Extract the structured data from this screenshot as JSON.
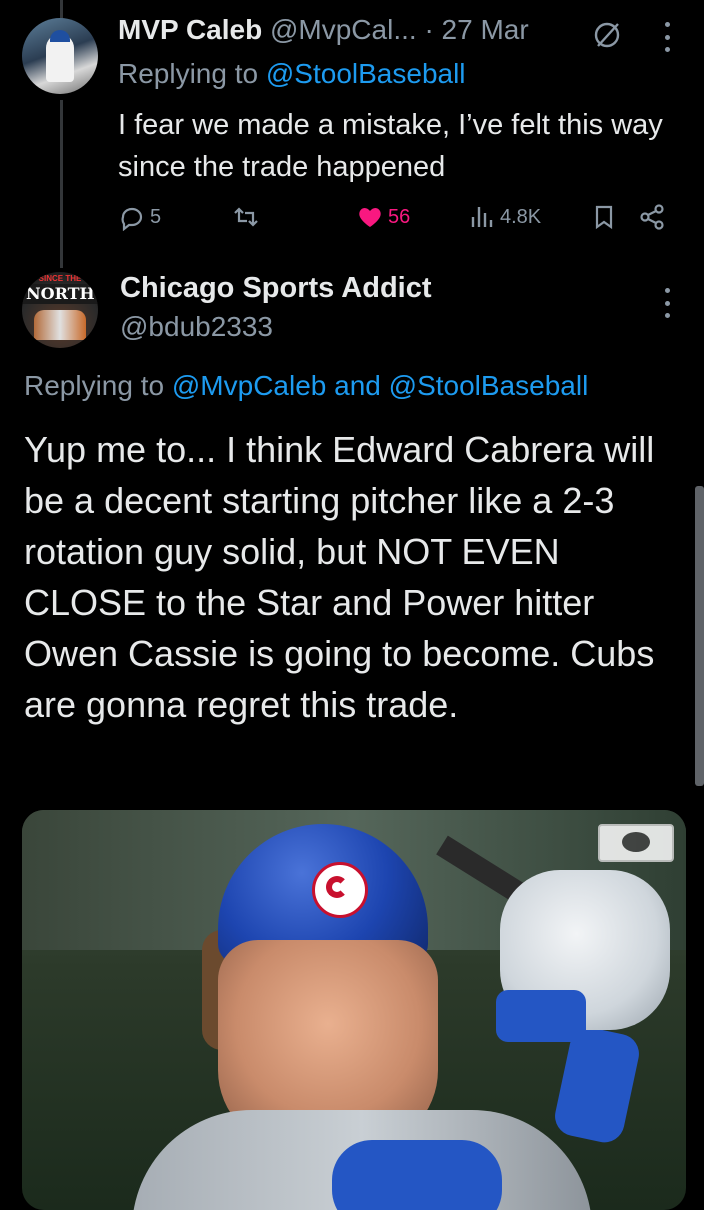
{
  "reply_tweet": {
    "display_name": "MVP Caleb",
    "handle": "@MvpCal...",
    "separator": "·",
    "date": "27 Mar",
    "replying_prefix": "Replying to",
    "replying_to": "@StoolBaseball",
    "text": "I fear we made a mistake, I’ve felt this way since the trade happened",
    "stats": {
      "replies": "5",
      "retweets": "",
      "likes": "56",
      "views": "4.8K"
    },
    "icons": [
      "grok-icon",
      "more-icon",
      "reply-icon",
      "retweet-icon",
      "heart-icon",
      "views-icon",
      "bookmark-icon",
      "share-icon"
    ]
  },
  "main_tweet": {
    "display_name": "Chicago Sports Addict",
    "handle": "@bdub2333",
    "avatar_text": "NORTH",
    "avatar_small_text": "SINCE THE",
    "replying_prefix": "Replying to",
    "replying_to_1": "@MvpCaleb",
    "replying_and": "and",
    "replying_to_2": "@StoolBaseball",
    "text": "Yup me to... I think Edward Cabrera will be a decent starting pitcher like a 2-3 rotation guy solid, but NOT EVEN CLOSE to the Star and Power hitter Owen Cassie is going to become. Cubs are gonna regret this trade."
  },
  "colors": {
    "background": "#000000",
    "text": "#e7e9ea",
    "secondary": "#8b98a5",
    "link": "#1d9bf0",
    "like": "#f91880"
  }
}
